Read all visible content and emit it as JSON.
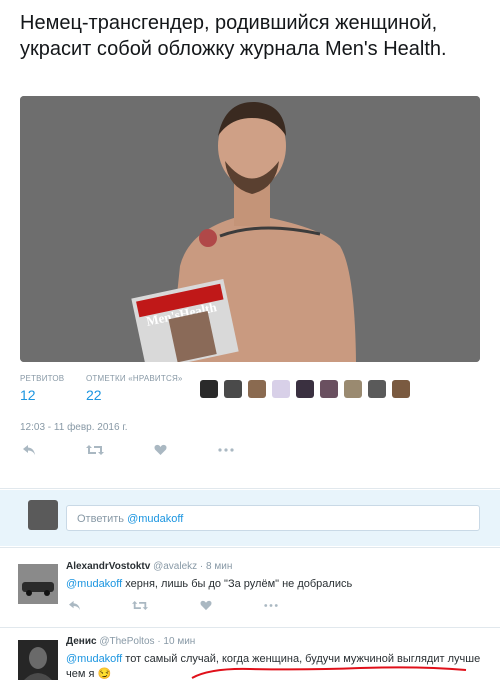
{
  "tweet": {
    "text": "Немец-трансгендер, родившийся женщиной, украсит собой обложку журнала Men's Health.",
    "magazine_title": "Men'sHealth",
    "retweets_label": "РЕТВИТОВ",
    "retweets_count": "12",
    "likes_label": "ОТМЕТКИ «НРАВИТСЯ»",
    "likes_count": "22",
    "timestamp": "12:03 - 11 февр. 2016 г.",
    "actions": {
      "reply_icon": "reply-icon",
      "retweet_icon": "retweet-icon",
      "like_icon": "heart-icon",
      "more_icon": "more-icon"
    }
  },
  "compose": {
    "placeholder_prefix": "Ответить",
    "mention": "@mudakoff"
  },
  "replies": [
    {
      "name": "AlexandrVostoktv",
      "handle": "@avalekz",
      "time": "· 8 мин",
      "mention": "@mudakoff",
      "text": " херня, лишь бы до \"За рулём\" не добрались"
    },
    {
      "name": "Денис",
      "handle": "@ThePoltos",
      "time": "· 10 мин",
      "mention": "@mudakoff",
      "text": " тот самый случай, когда женщина, будучи мужчиной выглядит лучше чем я",
      "emoji": "😏"
    }
  ],
  "colors": {
    "accent": "#1b95e0",
    "muted": "#8899a6",
    "compose_bg": "#e8f4fb",
    "annotation": "#e0101a"
  }
}
